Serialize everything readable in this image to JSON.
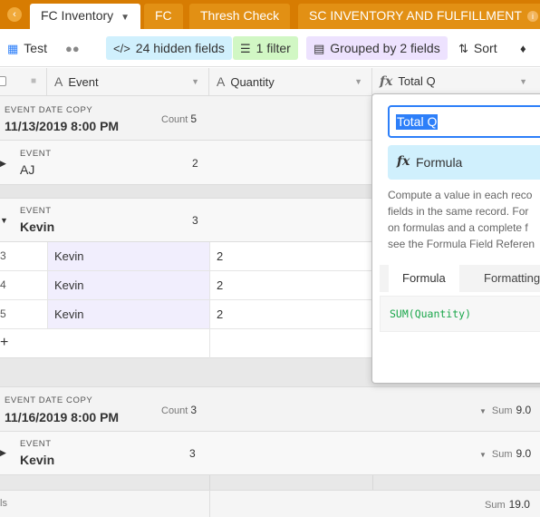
{
  "tabs": {
    "back_icon": "chevron-left-icon",
    "items": [
      {
        "label": "FC Inventory",
        "active": true
      },
      {
        "label": "FC",
        "active": false
      },
      {
        "label": "Thresh Check",
        "active": false
      },
      {
        "label": "SC INVENTORY AND FULFILLMENT",
        "active": false
      }
    ],
    "info_glyph": "i"
  },
  "toolbar": {
    "view_name": "Test",
    "hidden_fields": "24 hidden fields",
    "filter": "1 filter",
    "grouped": "Grouped by 2 fields",
    "sort": "Sort"
  },
  "columns": [
    {
      "name": "Event",
      "type_glyph": "A"
    },
    {
      "name": "Quantity",
      "type_glyph": "A"
    },
    {
      "name": "Total Q",
      "type_glyph": "fx"
    }
  ],
  "groups": [
    {
      "label": "EVENT DATE COPY",
      "value": "11/13/2019 8:00 PM",
      "count_label": "Count",
      "count": "5",
      "subgroups": [
        {
          "label": "EVENT",
          "value": "AJ",
          "count": "2"
        },
        {
          "label": "EVENT",
          "value": "Kevin",
          "count": "3",
          "rows": [
            {
              "num": "3",
              "event": "Kevin",
              "qty": "2"
            },
            {
              "num": "4",
              "event": "Kevin",
              "qty": "2"
            },
            {
              "num": "5",
              "event": "Kevin",
              "qty": "2"
            }
          ]
        }
      ]
    },
    {
      "label": "EVENT DATE COPY",
      "value": "11/16/2019 8:00 PM",
      "count_label": "Count",
      "count": "3",
      "sum_label": "Sum",
      "sum": "9.0",
      "subgroups": [
        {
          "label": "EVENT",
          "value": "Kevin",
          "count": "3",
          "sum_label": "Sum",
          "sum": "9.0"
        }
      ]
    }
  ],
  "footer": {
    "left_text": "ls",
    "sum_label": "Sum",
    "sum": "19.0"
  },
  "popover": {
    "field_name": "Total Q",
    "field_type": "Formula",
    "description_lines": [
      "Compute a value in each reco",
      "fields in the same record. For",
      "on formulas and a complete f",
      "see the Formula Field Referen"
    ],
    "tabs": [
      "Formula",
      "Formatting"
    ],
    "formula": "SUM(Quantity)"
  },
  "colors": {
    "tabbar": "#d77c02",
    "accent": "#2d7ff9",
    "formula_green": "#19a64a"
  }
}
